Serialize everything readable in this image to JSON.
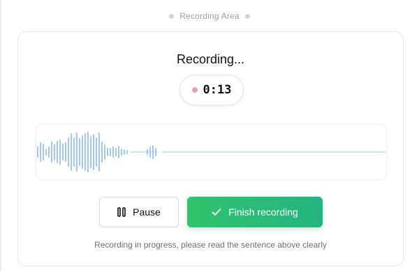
{
  "header": {
    "section_label": "Recording Area"
  },
  "recorder": {
    "title": "Recording...",
    "timer": "0:13",
    "pause_label": "Pause",
    "finish_label": "Finish recording",
    "hint": "Recording in progress, please read the sentence above clearly"
  },
  "icons": {
    "pause": "pause-icon",
    "finish": "check-icon",
    "recording_indicator": "record-dot"
  },
  "colors": {
    "accent_green": "#2fc46d",
    "waveform": "#9ec8f0",
    "recording_dot": "#e6a2a2"
  }
}
